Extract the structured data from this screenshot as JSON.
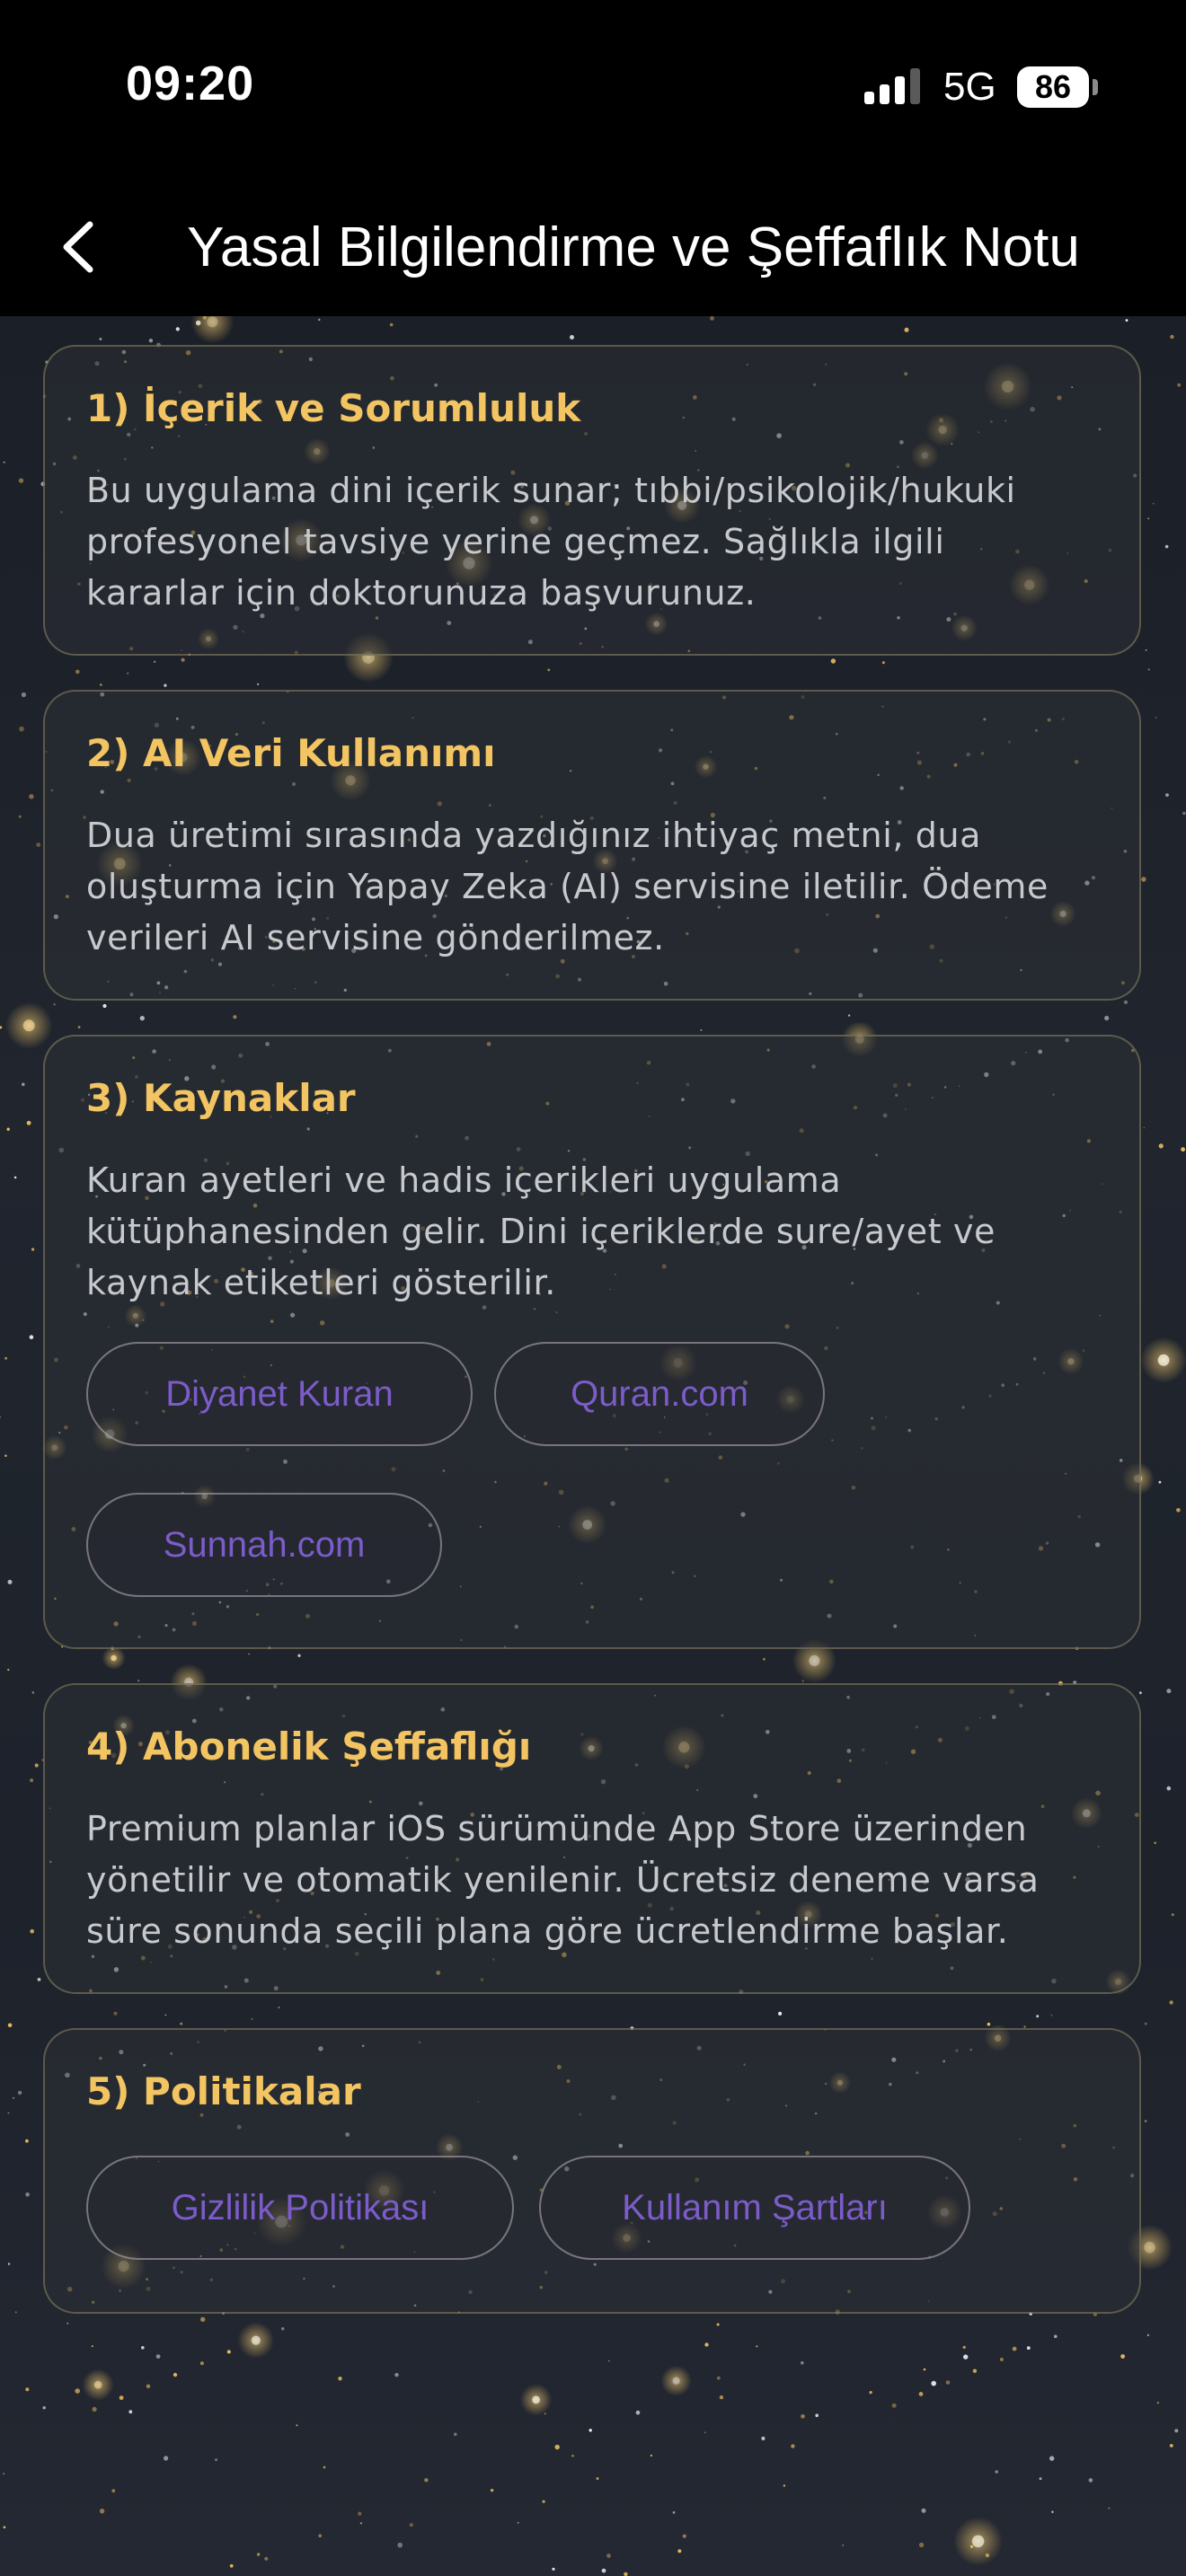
{
  "status_bar": {
    "time": "09:20",
    "network": "5G",
    "battery": "86"
  },
  "nav": {
    "title": "Yasal Bilgilendirme ve Şeffaflık Notu"
  },
  "sections": [
    {
      "title": "1) İçerik ve Sorumluluk",
      "lines": [
        "Bu uygulama dini içerik sunar; tıbbi/psikolojik/hukuki",
        "profesyonel tavsiye yerine geçmez. Sağlıkla ilgili",
        "kararlar için doktorunuza başvurunuz."
      ]
    },
    {
      "title": "2) AI Veri Kullanımı",
      "lines": [
        "Dua üretimi sırasında yazdığınız ihtiyaç metni, dua",
        "oluşturma için Yapay Zeka (AI) servisine iletilir. Ödeme",
        "verileri AI servisine gönderilmez."
      ]
    },
    {
      "title": "3) Kaynaklar",
      "lines": [
        "Kuran ayetleri ve hadis içerikleri uygulama",
        "kütüphanesinden gelir. Dini içeriklerde sure/ayet ve",
        "kaynak etiketleri gösterilir."
      ],
      "links": [
        "Diyanet Kuran",
        "Quran.com",
        "Sunnah.com"
      ]
    },
    {
      "title": "4) Abonelik Şeffaflığı",
      "lines": [
        "Premium planlar iOS sürümünde App Store üzerinden",
        "yönetilir ve otomatik yenilenir. Ücretsiz deneme varsa",
        "süre sonunda seçili plana göre ücretlendirme başlar."
      ]
    },
    {
      "title": "5) Politikalar",
      "links": [
        "Gizlilik Politikası",
        "Kullanım Şartları"
      ]
    }
  ],
  "colors": {
    "accent_title": "#f2c462",
    "link": "#7b5cc9",
    "background": "#1c2029"
  }
}
